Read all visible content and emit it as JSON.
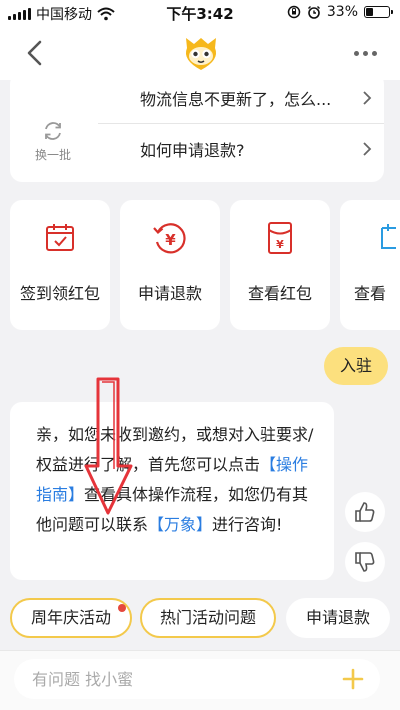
{
  "status_bar": {
    "carrier": "中国移动",
    "time": "下午3:42",
    "battery": "33%",
    "battery_level": 0.33
  },
  "faq": {
    "refresh_label": "换一批",
    "items": [
      {
        "text": "物流信息不更新了，怎么..."
      },
      {
        "text": "如何申请退款?"
      }
    ]
  },
  "shortcuts": [
    {
      "label": "签到领红包",
      "icon": "calendar-check-icon"
    },
    {
      "label": "申请退款",
      "icon": "yen-refund-icon"
    },
    {
      "label": "查看红包",
      "icon": "red-envelope-icon"
    },
    {
      "label": "查看",
      "icon": "partial-icon"
    }
  ],
  "user_message": "入驻",
  "bot_message": {
    "part1": "亲，如您未收到邀约，或想对入驻要求/权益进行了解，首先您可以点击",
    "link1": "【操作指南】",
    "part2": "查看具体操作流程，如您仍有其他问题可以联系",
    "link2": "【万象】",
    "part3": "进行咨询!"
  },
  "quick_replies": [
    {
      "label": "周年庆活动",
      "highlight": true,
      "badge": true
    },
    {
      "label": "热门活动问题",
      "highlight": true,
      "badge": false
    },
    {
      "label": "申请退款",
      "highlight": false,
      "badge": false
    }
  ],
  "input": {
    "placeholder": "有问题 找小蜜",
    "value": ""
  },
  "colors": {
    "accent": "#f3c94b",
    "bubble": "#fce07e",
    "link": "#2a7de1",
    "icon_red": "#d8302a"
  }
}
